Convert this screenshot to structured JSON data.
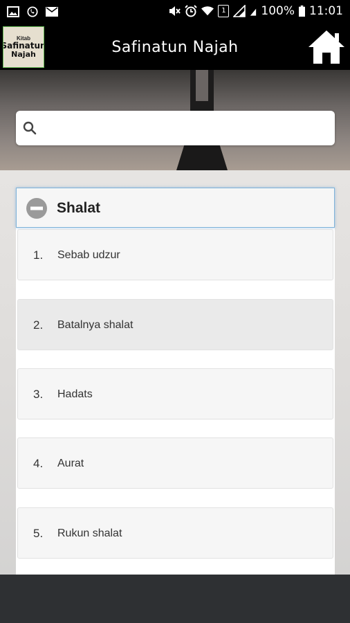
{
  "status_bar": {
    "battery": "100%",
    "time": "11:01",
    "sim_slot": "1"
  },
  "app_bar": {
    "logo_line1": "Kitab",
    "logo_line2": "Safinatun",
    "logo_line3": "Najah",
    "title": "Safinatun Najah",
    "home_icon": "home-icon"
  },
  "search": {
    "value": "",
    "placeholder": ""
  },
  "section": {
    "title": "Shalat",
    "expanded": true,
    "items": [
      {
        "number": "1.",
        "label": "Sebab udzur"
      },
      {
        "number": "2.",
        "label": "Batalnya shalat"
      },
      {
        "number": "3.",
        "label": "Hadats"
      },
      {
        "number": "4.",
        "label": "Aurat"
      },
      {
        "number": "5.",
        "label": "Rukun shalat"
      }
    ]
  }
}
